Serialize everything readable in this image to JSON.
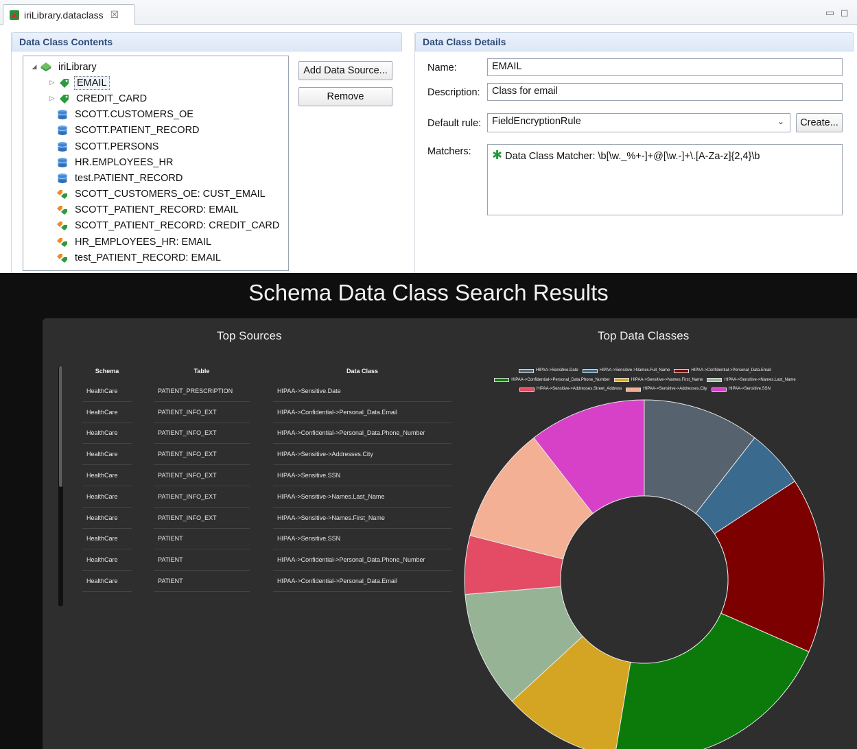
{
  "editor": {
    "tab_title": "iriLibrary.dataclass",
    "tab_close": "☒",
    "minimize_icon": "▭",
    "maximize_icon": "◻",
    "contents_header": "Data Class Contents",
    "details_header": "Data Class Details",
    "tree": [
      {
        "label": "iriLibrary",
        "icon": "library-icon",
        "twisty": "◢",
        "indent": 0
      },
      {
        "label": "EMAIL",
        "icon": "tag-icon",
        "twisty": "▷",
        "indent": 1,
        "selected": true
      },
      {
        "label": "CREDIT_CARD",
        "icon": "tag-icon",
        "twisty": "▷",
        "indent": 1
      },
      {
        "label": "SCOTT.CUSTOMERS_OE",
        "icon": "database-icon",
        "twisty": "",
        "indent": 1
      },
      {
        "label": "SCOTT.PATIENT_RECORD",
        "icon": "database-icon",
        "twisty": "",
        "indent": 1
      },
      {
        "label": "SCOTT.PERSONS",
        "icon": "database-icon",
        "twisty": "",
        "indent": 1
      },
      {
        "label": "HR.EMPLOYEES_HR",
        "icon": "database-icon",
        "twisty": "",
        "indent": 1
      },
      {
        "label": "test.PATIENT_RECORD",
        "icon": "database-icon",
        "twisty": "",
        "indent": 1
      },
      {
        "label": "SCOTT_CUSTOMERS_OE: CUST_EMAIL",
        "icon": "tag-link-icon",
        "twisty": "",
        "indent": 1
      },
      {
        "label": "SCOTT_PATIENT_RECORD: EMAIL",
        "icon": "tag-link-icon",
        "twisty": "",
        "indent": 1
      },
      {
        "label": "SCOTT_PATIENT_RECORD: CREDIT_CARD",
        "icon": "tag-link-icon",
        "twisty": "",
        "indent": 1
      },
      {
        "label": "HR_EMPLOYEES_HR: EMAIL",
        "icon": "tag-link-icon",
        "twisty": "",
        "indent": 1
      },
      {
        "label": "test_PATIENT_RECORD: EMAIL",
        "icon": "tag-link-icon",
        "twisty": "",
        "indent": 1
      }
    ],
    "add_source_button": "Add Data Source...",
    "remove_button": "Remove",
    "name_label": "Name:",
    "name_value": "EMAIL",
    "description_label": "Description:",
    "description_value": "Class for email",
    "default_rule_label": "Default rule:",
    "default_rule_value": "FieldEncryptionRule",
    "create_button": "Create...",
    "matchers_label": "Matchers:",
    "matcher_icon": "✱",
    "matcher_text": "Data Class Matcher: \\b[\\w._%+-]+@[\\w.-]+\\.[A-Za-z]{2,4}\\b"
  },
  "dashboard": {
    "title": "Schema Data Class Search Results",
    "top_sources_title": "Top Sources",
    "top_classes_title": "Top Data Classes",
    "columns": [
      "Schema",
      "Table",
      "Data Class"
    ],
    "rows": [
      [
        "HealthCare",
        "PATIENT_PRESCRIPTION",
        "HIPAA->Sensitive.Date"
      ],
      [
        "HealthCare",
        "PATIENT_INFO_EXT",
        "HIPAA->Confidential->Personal_Data.Email"
      ],
      [
        "HealthCare",
        "PATIENT_INFO_EXT",
        "HIPAA->Confidential->Personal_Data.Phone_Number"
      ],
      [
        "HealthCare",
        "PATIENT_INFO_EXT",
        "HIPAA->Sensitive->Addresses.City"
      ],
      [
        "HealthCare",
        "PATIENT_INFO_EXT",
        "HIPAA->Sensitive.SSN"
      ],
      [
        "HealthCare",
        "PATIENT_INFO_EXT",
        "HIPAA->Sensitive->Names.Last_Name"
      ],
      [
        "HealthCare",
        "PATIENT_INFO_EXT",
        "HIPAA->Sensitive->Names.First_Name"
      ],
      [
        "HealthCare",
        "PATIENT",
        "HIPAA->Sensitive.SSN"
      ],
      [
        "HealthCare",
        "PATIENT",
        "HIPAA->Confidential->Personal_Data.Phone_Number"
      ],
      [
        "HealthCare",
        "PATIENT",
        "HIPAA->Confidential->Personal_Data.Email"
      ]
    ]
  },
  "chart_data": {
    "type": "pie",
    "title": "Top Data Classes",
    "donut": true,
    "legend": "top",
    "series": [
      {
        "name": "HIPAA->Sensitive.Date",
        "value": 11,
        "color": "#56626e"
      },
      {
        "name": "HIPAA->Sensitive->Names.Full_Name",
        "value": 5.5,
        "color": "#3a6a8e"
      },
      {
        "name": "HIPAA->Confidential->Personal_Data.Email",
        "value": 16.5,
        "color": "#7d0000"
      },
      {
        "name": "HIPAA->Confidential->Personal_Data.Phone_Number",
        "value": 22,
        "color": "#0b7a0b"
      },
      {
        "name": "HIPAA->Sensitive->Names.First_Name",
        "value": 11,
        "color": "#d4a423"
      },
      {
        "name": "HIPAA->Sensitive->Names.Last_Name",
        "value": 11,
        "color": "#97b396"
      },
      {
        "name": "HIPAA->Sensitive->Addresses.Street_Address",
        "value": 5.5,
        "color": "#e34c64"
      },
      {
        "name": "HIPAA->Sensitive->Addresses.City",
        "value": 11,
        "color": "#f4b095"
      },
      {
        "name": "HIPAA->Sensitive.SSN",
        "value": 11,
        "color": "#d641c8"
      }
    ]
  }
}
